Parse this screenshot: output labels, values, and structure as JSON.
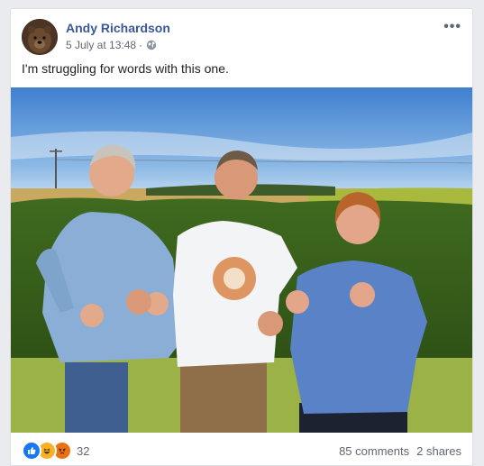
{
  "post": {
    "author": "Andy Richardson",
    "date": "5 July at 13:48",
    "separator": "·",
    "privacy_icon": "globe-icon",
    "more_icon": "more-options-icon",
    "more_symbol": "•••",
    "text": "I'm struggling for words with this one."
  },
  "footer": {
    "reaction_icons": [
      "like-icon",
      "haha-icon",
      "angry-icon"
    ],
    "reaction_count": "32",
    "comments": "85 comments",
    "shares": "2 shares"
  },
  "colors": {
    "author_link": "#385898",
    "like": "#1877f2",
    "haha": "#f7b125",
    "angry": "#e9710f"
  }
}
